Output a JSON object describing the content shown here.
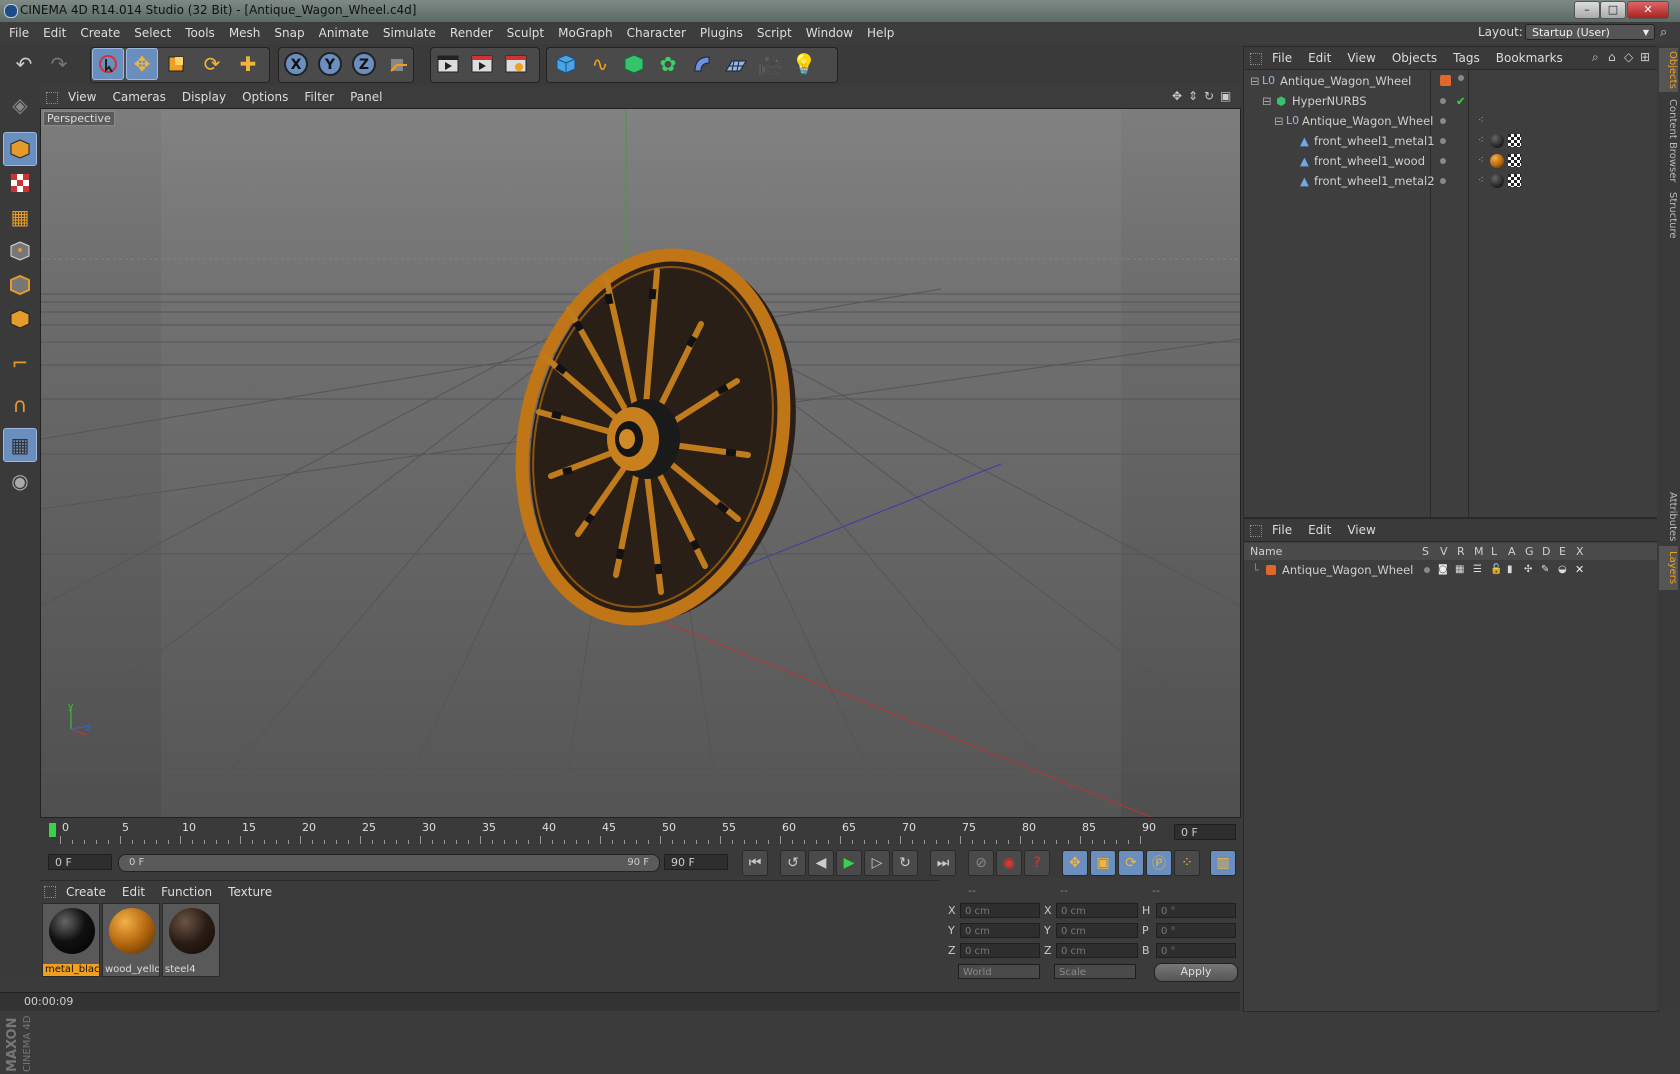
{
  "window": {
    "title": "CINEMA 4D R14.014 Studio (32 Bit) - [Antique_Wagon_Wheel.c4d]",
    "minimize": "–",
    "maximize": "□",
    "close": "✕"
  },
  "menubar": {
    "items": [
      "File",
      "Edit",
      "Create",
      "Select",
      "Tools",
      "Mesh",
      "Snap",
      "Animate",
      "Simulate",
      "Render",
      "Sculpt",
      "MoGraph",
      "Character",
      "Plugins",
      "Script",
      "Window",
      "Help"
    ],
    "layout_label": "Layout:",
    "layout_value": "Startup (User)"
  },
  "viewport": {
    "menu": [
      "View",
      "Cameras",
      "Display",
      "Options",
      "Filter",
      "Panel"
    ],
    "label": "Perspective",
    "axis_y": "y",
    "axis_z": "z"
  },
  "timeline": {
    "ticks": [
      "0",
      "5",
      "10",
      "15",
      "20",
      "25",
      "30",
      "35",
      "40",
      "45",
      "50",
      "55",
      "60",
      "65",
      "70",
      "75",
      "80",
      "85",
      "90"
    ],
    "current_frame": "0 F",
    "start_field": "0 F",
    "range_start": "0 F",
    "range_end": "90 F",
    "end_field": "90 F"
  },
  "material_manager": {
    "menu": [
      "Create",
      "Edit",
      "Function",
      "Texture"
    ],
    "materials": [
      {
        "name": "metal_black",
        "color": "#111111",
        "selected": true
      },
      {
        "name": "wood_yellow",
        "color": "#b5670e",
        "selected": false
      },
      {
        "name": "steel4",
        "color": "#2a1c14",
        "selected": false
      }
    ]
  },
  "coordinates": {
    "headers": [
      "--",
      "--",
      "--"
    ],
    "rows": [
      {
        "a": "X",
        "av": "0 cm",
        "b": "X",
        "bv": "0 cm",
        "c": "H",
        "cv": "0 °"
      },
      {
        "a": "Y",
        "av": "0 cm",
        "b": "Y",
        "bv": "0 cm",
        "c": "P",
        "cv": "0 °"
      },
      {
        "a": "Z",
        "av": "0 cm",
        "b": "Z",
        "bv": "0 cm",
        "c": "B",
        "cv": "0 °"
      }
    ],
    "mode": "World",
    "size_mode": "Scale",
    "apply": "Apply"
  },
  "status": {
    "text": "00:00:09"
  },
  "objects_panel": {
    "menu": [
      "File",
      "Edit",
      "View",
      "Objects",
      "Tags",
      "Bookmarks"
    ],
    "items": [
      {
        "name": "Antique_Wagon_Wheel",
        "indent": 0
      },
      {
        "name": "HyperNURBS",
        "indent": 1
      },
      {
        "name": "Antique_Wagon_Wheel",
        "indent": 2
      },
      {
        "name": "front_wheel1_metal1",
        "indent": 3
      },
      {
        "name": "front_wheel1_wood",
        "indent": 3
      },
      {
        "name": "front_wheel1_metal2",
        "indent": 3
      }
    ]
  },
  "layers_panel": {
    "menu": [
      "File",
      "Edit",
      "View"
    ],
    "columns": [
      "Name",
      "S",
      "V",
      "R",
      "M",
      "L",
      "A",
      "G",
      "D",
      "E",
      "X"
    ],
    "rows": [
      {
        "name": "Antique_Wagon_Wheel",
        "color": "#e0682a"
      }
    ]
  },
  "side_tabs": [
    "Objects",
    "Content Browser",
    "Structure",
    "Attributes",
    "Layers"
  ],
  "colors": {
    "accent_selection": "#6a8fbf",
    "object_orange": "#e49b2a",
    "play_green": "#39d34a"
  }
}
